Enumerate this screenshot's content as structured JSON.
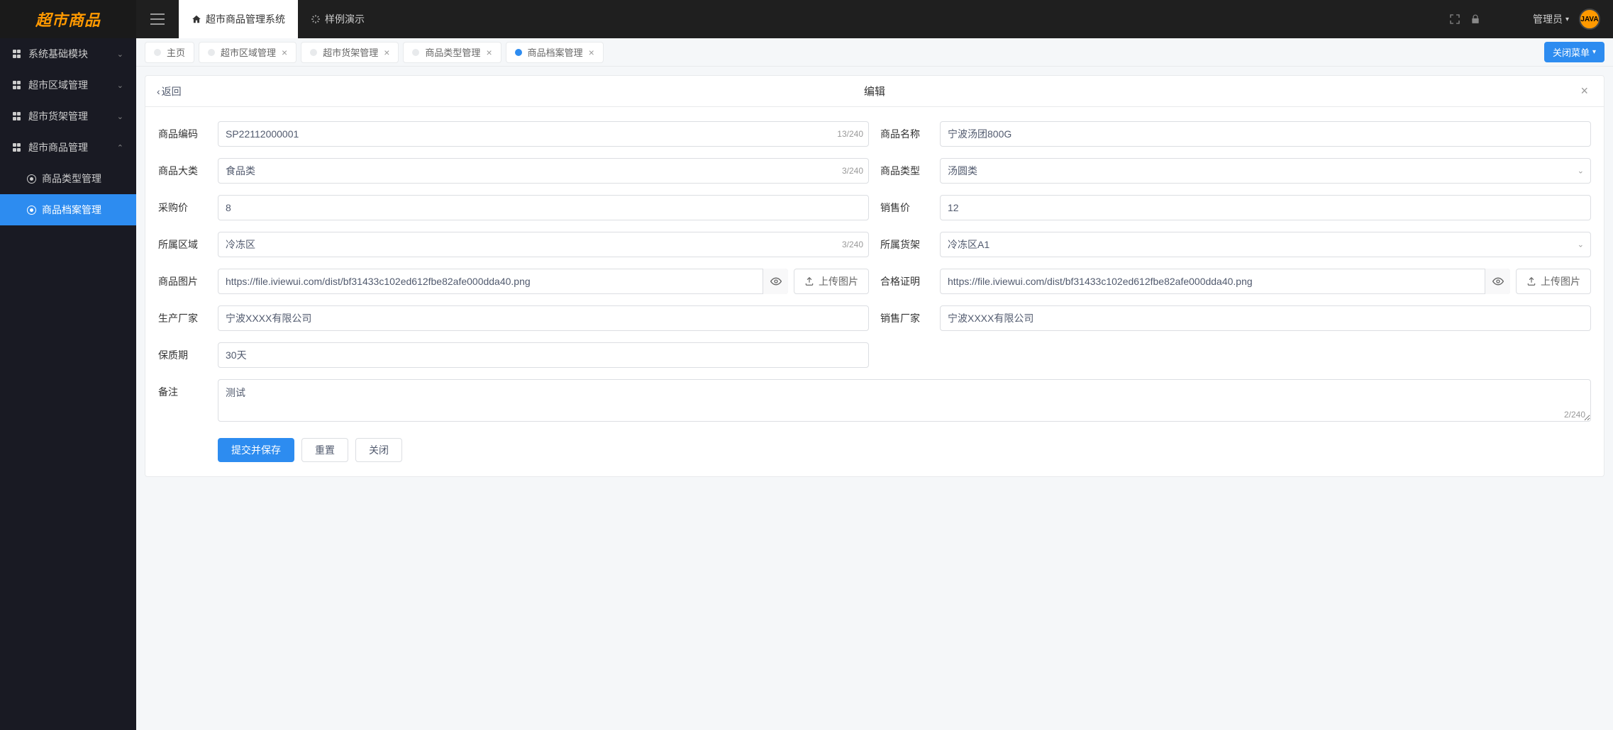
{
  "header": {
    "logo": "超市商品",
    "topTabs": [
      {
        "label": "超市商品管理系统",
        "active": true
      },
      {
        "label": "样例演示",
        "active": false
      }
    ],
    "user": "管理员",
    "avatar": "JAVA"
  },
  "sidebar": {
    "items": [
      {
        "label": "系统基础模块",
        "expanded": false
      },
      {
        "label": "超市区域管理",
        "expanded": false
      },
      {
        "label": "超市货架管理",
        "expanded": false
      },
      {
        "label": "超市商品管理",
        "expanded": true
      }
    ],
    "subItems": [
      {
        "label": "商品类型管理",
        "active": false
      },
      {
        "label": "商品档案管理",
        "active": true
      }
    ]
  },
  "tabs": {
    "items": [
      {
        "label": "主页",
        "closable": false,
        "active": false
      },
      {
        "label": "超市区域管理",
        "closable": true,
        "active": false
      },
      {
        "label": "超市货架管理",
        "closable": true,
        "active": false
      },
      {
        "label": "商品类型管理",
        "closable": true,
        "active": false
      },
      {
        "label": "商品档案管理",
        "closable": true,
        "active": true
      }
    ],
    "closeMenu": "关闭菜单"
  },
  "card": {
    "back": "返回",
    "title": "编辑"
  },
  "form": {
    "code": {
      "label": "商品编码",
      "value": "SP22112000001",
      "counter": "13/240"
    },
    "name": {
      "label": "商品名称",
      "value": "宁波汤团800G"
    },
    "category": {
      "label": "商品大类",
      "value": "食品类",
      "counter": "3/240"
    },
    "type": {
      "label": "商品类型",
      "value": "汤圆类"
    },
    "purchasePrice": {
      "label": "采购价",
      "value": "8"
    },
    "salePrice": {
      "label": "销售价",
      "value": "12"
    },
    "area": {
      "label": "所属区域",
      "value": "冷冻区",
      "counter": "3/240"
    },
    "shelf": {
      "label": "所属货架",
      "value": "冷冻区A1"
    },
    "image": {
      "label": "商品图片",
      "value": "https://file.iviewui.com/dist/bf31433c102ed612fbe82afe000dda40.png",
      "upload": "上传图片"
    },
    "cert": {
      "label": "合格证明",
      "value": "https://file.iviewui.com/dist/bf31433c102ed612fbe82afe000dda40.png",
      "upload": "上传图片"
    },
    "producer": {
      "label": "生产厂家",
      "value": "宁波XXXX有限公司"
    },
    "seller": {
      "label": "销售厂家",
      "value": "宁波XXXX有限公司"
    },
    "shelfLife": {
      "label": "保质期",
      "value": "30天"
    },
    "remark": {
      "label": "备注",
      "value": "测试",
      "counter": "2/240"
    }
  },
  "actions": {
    "submit": "提交并保存",
    "reset": "重置",
    "close": "关闭"
  }
}
